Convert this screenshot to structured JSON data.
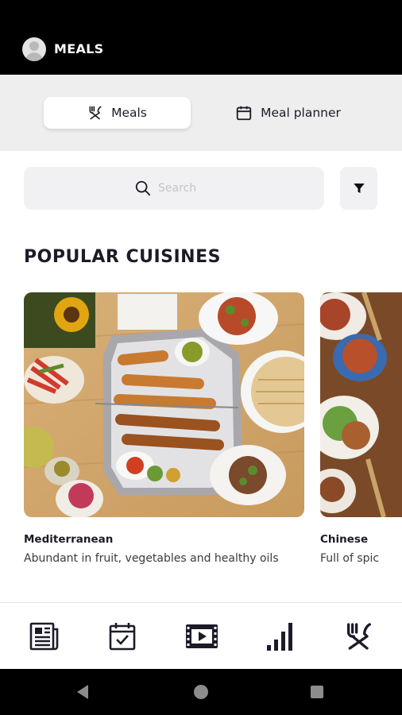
{
  "app_bar": {
    "title": "MEALS"
  },
  "tabs": [
    {
      "label": "Meals",
      "icon": "fork-knife-icon",
      "selected": true
    },
    {
      "label": "Meal planner",
      "icon": "calendar-icon",
      "selected": false
    }
  ],
  "search": {
    "placeholder": "Search",
    "value": ""
  },
  "section": {
    "title": "POPULAR CUISINES"
  },
  "cuisines": [
    {
      "name": "Mediterranean",
      "description": "Abundant in fruit, vegetables and healthy oils"
    },
    {
      "name": "Chinese",
      "description": "Full of spic"
    }
  ],
  "bottom_nav": [
    {
      "icon": "newspaper-icon"
    },
    {
      "icon": "calendar-check-icon"
    },
    {
      "icon": "film-icon"
    },
    {
      "icon": "bar-chart-icon"
    },
    {
      "icon": "fork-knife-icon",
      "selected": true
    }
  ],
  "colors": {
    "app_bar": "#000000",
    "tab_area": "#eeeeee",
    "text": "#1c1c28"
  }
}
